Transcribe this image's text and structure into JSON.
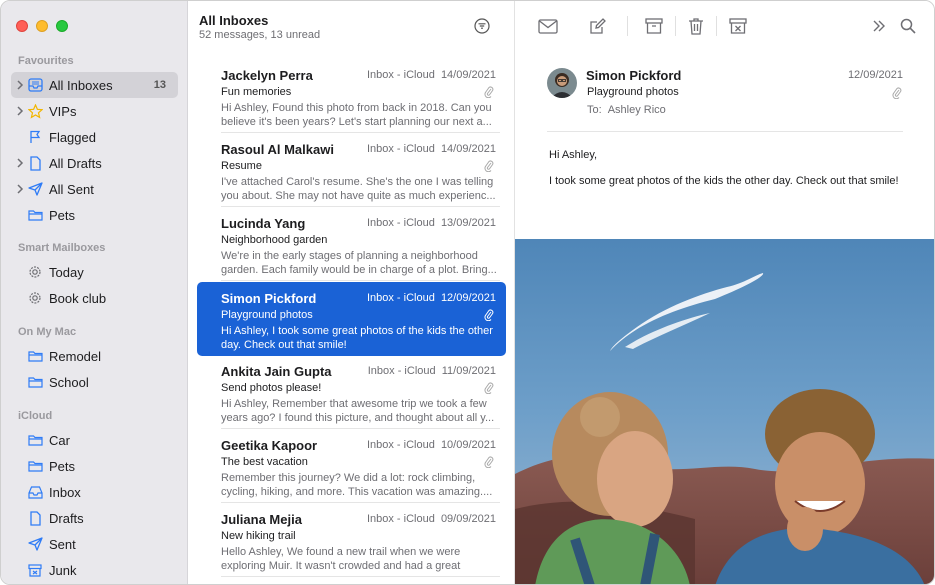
{
  "sidebar": {
    "favourites": {
      "heading": "Favourites",
      "items": [
        {
          "label": "All Inboxes",
          "badge": "13",
          "icon": "inbox-tray-icon"
        },
        {
          "label": "VIPs",
          "icon": "star-icon"
        },
        {
          "label": "Flagged",
          "icon": "flag-icon"
        },
        {
          "label": "All Drafts",
          "icon": "document-icon"
        },
        {
          "label": "All Sent",
          "icon": "paper-plane-icon"
        },
        {
          "label": "Pets",
          "icon": "folder-icon"
        }
      ]
    },
    "smart": {
      "heading": "Smart Mailboxes",
      "items": [
        {
          "label": "Today",
          "icon": "gear-icon"
        },
        {
          "label": "Book club",
          "icon": "gear-icon"
        }
      ]
    },
    "mac": {
      "heading": "On My Mac",
      "items": [
        {
          "label": "Remodel",
          "icon": "folder-icon"
        },
        {
          "label": "School",
          "icon": "folder-icon"
        }
      ]
    },
    "icloud": {
      "heading": "iCloud",
      "items": [
        {
          "label": "Car",
          "icon": "folder-icon"
        },
        {
          "label": "Pets",
          "icon": "folder-icon"
        },
        {
          "label": "Inbox",
          "icon": "inbox-tray-icon"
        },
        {
          "label": "Drafts",
          "icon": "document-icon"
        },
        {
          "label": "Sent",
          "icon": "paper-plane-icon"
        },
        {
          "label": "Junk",
          "icon": "junk-icon"
        }
      ]
    }
  },
  "list": {
    "title": "All Inboxes",
    "subtitle": "52 messages, 13 unread",
    "messages": [
      {
        "sender": "Jackelyn Perra",
        "mailbox": "Inbox - iCloud",
        "date": "14/09/2021",
        "subject": "Fun memories",
        "preview": "Hi Ashley, Found this photo from back in 2018. Can you believe it's been years? Let's start planning our next a..."
      },
      {
        "sender": "Rasoul Al Malkawi",
        "mailbox": "Inbox - iCloud",
        "date": "14/09/2021",
        "subject": "Resume",
        "preview": "I've attached Carol's resume. She's the one I was telling you about. She may not have quite as much experienc..."
      },
      {
        "sender": "Lucinda Yang",
        "mailbox": "Inbox - iCloud",
        "date": "13/09/2021",
        "subject": "Neighborhood garden",
        "preview": "We're in the early stages of planning a neighborhood garden. Each family would be in charge of a plot. Bring..."
      },
      {
        "sender": "Simon Pickford",
        "mailbox": "Inbox - iCloud",
        "date": "12/09/2021",
        "subject": "Playground photos",
        "preview": "Hi Ashley, I took some great photos of the kids the other day. Check out that smile!"
      },
      {
        "sender": "Ankita Jain Gupta",
        "mailbox": "Inbox - iCloud",
        "date": "11/09/2021",
        "subject": "Send photos please!",
        "preview": "Hi Ashley, Remember that awesome trip we took a few years ago? I found this picture, and thought about all y..."
      },
      {
        "sender": "Geetika Kapoor",
        "mailbox": "Inbox - iCloud",
        "date": "10/09/2021",
        "subject": "The best vacation",
        "preview": "Remember this journey? We did a lot: rock climbing, cycling, hiking, and more. This vacation was amazing...."
      },
      {
        "sender": "Juliana Mejia",
        "mailbox": "Inbox - iCloud",
        "date": "09/09/2021",
        "subject": "New hiking trail",
        "preview": "Hello Ashley, We found a new trail when we were exploring Muir. It wasn't crowded and had a great view...."
      }
    ]
  },
  "reader": {
    "sender": "Simon Pickford",
    "subject": "Playground photos",
    "to_label": "To:",
    "to_name": "Ashley Rico",
    "date": "12/09/2021",
    "greeting": "Hi Ashley,",
    "body": "I took some great photos of the kids the other day. Check out that smile!"
  },
  "colors": {
    "accent": "#1a62d6",
    "sidebar_icon": "#2f7cf6"
  }
}
